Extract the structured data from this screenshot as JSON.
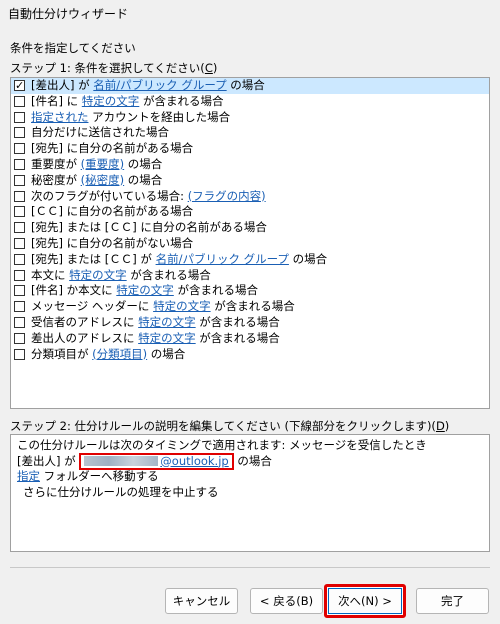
{
  "window": {
    "title": "自動仕分けウィザード"
  },
  "heading": "条件を指定してください",
  "step1": {
    "label": "ステップ 1: 条件を選択してください(",
    "key": "C",
    "tail": ")"
  },
  "conditions": [
    {
      "checked": true,
      "selected": true,
      "parts": [
        {
          "t": "[差出人] が "
        },
        {
          "t": "名前/パブリック グループ",
          "link": true
        },
        {
          "t": " の場合"
        }
      ]
    },
    {
      "checked": false,
      "parts": [
        {
          "t": "[件名] に "
        },
        {
          "t": "特定の文字",
          "link": true
        },
        {
          "t": " が含まれる場合"
        }
      ]
    },
    {
      "checked": false,
      "parts": [
        {
          "t": "指定された",
          "link": true
        },
        {
          "t": " アカウントを経由した場合"
        }
      ]
    },
    {
      "checked": false,
      "parts": [
        {
          "t": "自分だけに送信された場合"
        }
      ]
    },
    {
      "checked": false,
      "parts": [
        {
          "t": "[宛先] に自分の名前がある場合"
        }
      ]
    },
    {
      "checked": false,
      "parts": [
        {
          "t": "重要度が "
        },
        {
          "t": "(重要度)",
          "link": true
        },
        {
          "t": " の場合"
        }
      ]
    },
    {
      "checked": false,
      "parts": [
        {
          "t": "秘密度が "
        },
        {
          "t": "(秘密度)",
          "link": true
        },
        {
          "t": " の場合"
        }
      ]
    },
    {
      "checked": false,
      "parts": [
        {
          "t": "次のフラグが付いている場合: "
        },
        {
          "t": "(フラグの内容)",
          "link": true
        }
      ]
    },
    {
      "checked": false,
      "parts": [
        {
          "t": "[ＣＣ] に自分の名前がある場合"
        }
      ]
    },
    {
      "checked": false,
      "parts": [
        {
          "t": "[宛先] または [ＣＣ] に自分の名前がある場合"
        }
      ]
    },
    {
      "checked": false,
      "parts": [
        {
          "t": "[宛先] に自分の名前がない場合"
        }
      ]
    },
    {
      "checked": false,
      "parts": [
        {
          "t": "[宛先] または [ＣＣ] が "
        },
        {
          "t": "名前/パブリック グループ",
          "link": true
        },
        {
          "t": " の場合"
        }
      ]
    },
    {
      "checked": false,
      "parts": [
        {
          "t": "本文に "
        },
        {
          "t": "特定の文字",
          "link": true
        },
        {
          "t": " が含まれる場合"
        }
      ]
    },
    {
      "checked": false,
      "parts": [
        {
          "t": "[件名] か本文に "
        },
        {
          "t": "特定の文字",
          "link": true
        },
        {
          "t": " が含まれる場合"
        }
      ]
    },
    {
      "checked": false,
      "parts": [
        {
          "t": "メッセージ ヘッダーに "
        },
        {
          "t": "特定の文字",
          "link": true
        },
        {
          "t": " が含まれる場合"
        }
      ]
    },
    {
      "checked": false,
      "parts": [
        {
          "t": "受信者のアドレスに "
        },
        {
          "t": "特定の文字",
          "link": true
        },
        {
          "t": " が含まれる場合"
        }
      ]
    },
    {
      "checked": false,
      "parts": [
        {
          "t": "差出人のアドレスに "
        },
        {
          "t": "特定の文字",
          "link": true
        },
        {
          "t": " が含まれる場合"
        }
      ]
    },
    {
      "checked": false,
      "parts": [
        {
          "t": "分類項目が "
        },
        {
          "t": "(分類項目)",
          "link": true
        },
        {
          "t": " の場合"
        }
      ]
    }
  ],
  "step2": {
    "label": "ステップ 2: 仕分けルールの説明を編集してください (下線部分をクリックします)(",
    "key": "D",
    "tail": ")"
  },
  "description": {
    "line1": "この仕分けルールは次のタイミングで適用されます: メッセージを受信したとき",
    "line2_prefix": "[差出人] が ",
    "email_domain": "@outlook.jp",
    "line2_suffix": " の場合",
    "line3_link": "指定",
    "line3_suffix": " フォルダーへ移動する",
    "line4": "さらに仕分けルールの処理を中止する"
  },
  "buttons": {
    "cancel": "キャンセル",
    "back": "< 戻る(B)",
    "next": "次へ(N) >",
    "finish": "完了"
  }
}
